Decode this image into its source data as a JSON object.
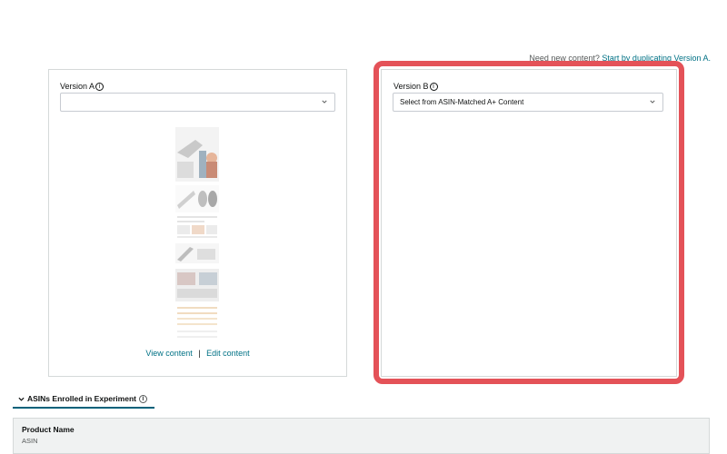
{
  "hint": {
    "prefix": "Need new content?",
    "link": "Start by duplicating Version A."
  },
  "version_a": {
    "label": "Version A",
    "select_value": "",
    "links": {
      "view": "View content",
      "separator": "|",
      "edit": "Edit content"
    }
  },
  "version_b": {
    "label": "Version B",
    "select_value": "Select from ASIN-Matched A+ Content"
  },
  "section_tab": {
    "label": "ASINs Enrolled in Experiment"
  },
  "table": {
    "header_title": "Product Name",
    "header_sub": "ASIN"
  },
  "colors": {
    "link": "#007185",
    "highlight": "#e45258",
    "tab_underline": "#00617a",
    "table_header_bg": "#f0f2f2"
  }
}
